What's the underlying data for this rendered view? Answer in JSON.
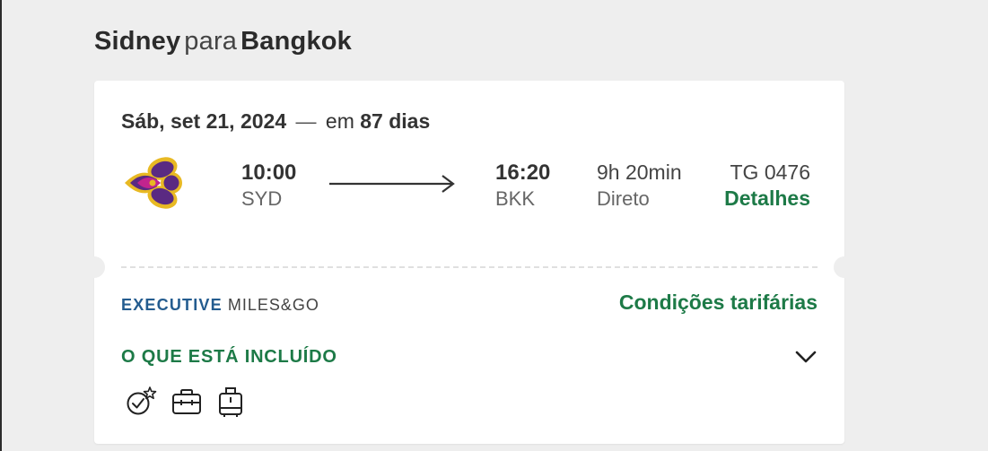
{
  "header": {
    "origin": "Sidney",
    "connector": "para",
    "destination": "Bangkok"
  },
  "flight": {
    "date": "Sáb, set 21, 2024",
    "date_separator": "—",
    "days_prefix": "em",
    "days": "87 dias",
    "airline_logo_icon": "thai-airways-logo",
    "departure": {
      "time": "10:00",
      "code": "SYD"
    },
    "arrival": {
      "time": "16:20",
      "code": "BKK"
    },
    "duration": "9h 20min",
    "stops": "Direto",
    "flight_number": "TG 0476",
    "details_label": "Detalhes"
  },
  "fare": {
    "class_label": "EXECUTIVE",
    "program_label": "MILES&GO",
    "conditions_label": "Condições tarifárias",
    "included_title": "O QUE ESTÁ INCLUÍDO",
    "amenities": [
      {
        "icon": "seat-selection-star-icon"
      },
      {
        "icon": "briefcase-icon"
      },
      {
        "icon": "carry-on-luggage-icon"
      }
    ]
  },
  "colors": {
    "accent_green": "#1d7a47",
    "executive_blue": "#245c8f",
    "background": "#eeeeee"
  }
}
